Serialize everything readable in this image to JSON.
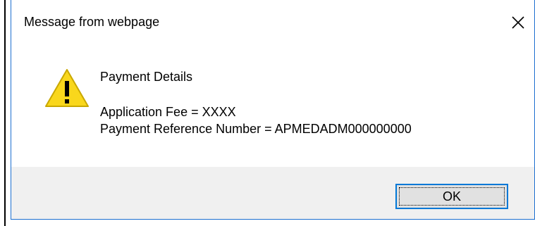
{
  "dialog": {
    "title": "Message from webpage",
    "close_icon": "close-icon",
    "warning_icon": "warning-icon",
    "heading": "Payment Details",
    "lines": [
      "Application Fee = XXXX",
      "Payment Reference Number = APMEDADM000000000"
    ],
    "ok_label": "OK"
  },
  "colors": {
    "window_border": "#1c6fd0",
    "footer_background": "#f0f0f0",
    "button_focus_border": "#0078d7",
    "warning_fill": "#f9d71c"
  }
}
